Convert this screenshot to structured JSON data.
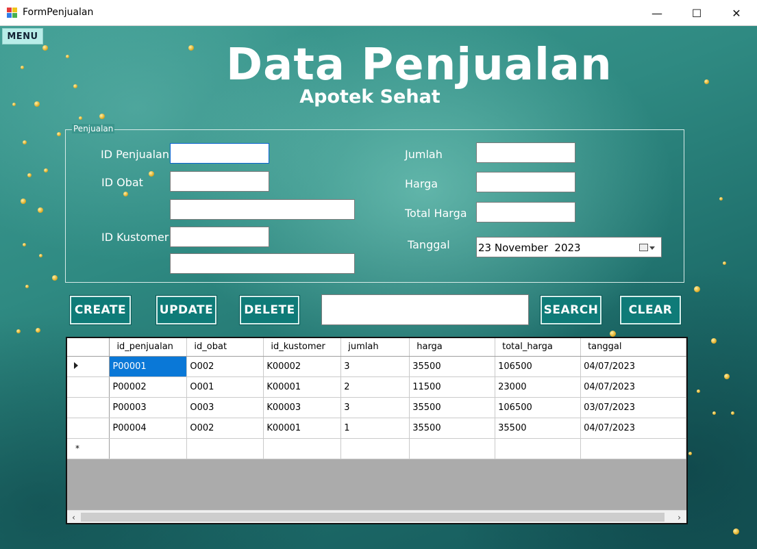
{
  "window": {
    "title": "FormPenjualan",
    "controls": {
      "minimize": "—",
      "maximize": "☐",
      "close": "✕"
    }
  },
  "menu": {
    "label": "MENU"
  },
  "header": {
    "title": "Data Penjualan",
    "subtitle": "Apotek Sehat"
  },
  "groupbox": {
    "legend": "Penjualan"
  },
  "form": {
    "id_penjualan_label": "ID Penjualan",
    "id_obat_label": "ID Obat",
    "id_kustomer_label": "ID Kustomer",
    "jumlah_label": "Jumlah",
    "harga_label": "Harga",
    "total_harga_label": "Total Harga",
    "tanggal_label": "Tanggal",
    "tanggal_value": "23 November  2023",
    "id_penjualan_value": "",
    "id_obat_value": "",
    "nama_obat_value": "",
    "id_kustomer_value": "",
    "nama_kustomer_value": "",
    "jumlah_value": "",
    "harga_value": "",
    "total_harga_value": ""
  },
  "buttons": {
    "create": "CREATE",
    "update": "UPDATE",
    "delete": "DELETE",
    "search": "SEARCH",
    "clear": "CLEAR"
  },
  "search": {
    "value": ""
  },
  "grid": {
    "columns": [
      "id_penjualan",
      "id_obat",
      "id_kustomer",
      "jumlah",
      "harga",
      "total_harga",
      "tanggal"
    ],
    "rows": [
      [
        "P00001",
        "O002",
        "K00002",
        "3",
        "35500",
        "106500",
        "04/07/2023"
      ],
      [
        "P00002",
        "O001",
        "K00001",
        "2",
        "11500",
        "23000",
        "04/07/2023"
      ],
      [
        "P00003",
        "O003",
        "K00003",
        "3",
        "35500",
        "106500",
        "03/07/2023"
      ],
      [
        "P00004",
        "O002",
        "K00001",
        "1",
        "35500",
        "35500",
        "04/07/2023"
      ]
    ],
    "new_row_marker": "*",
    "scroll_left": "‹",
    "scroll_right": "›"
  },
  "colors": {
    "button_bg": "#0f7b78",
    "selection": "#0a78d7",
    "menu_bg": "#b8ede8"
  }
}
